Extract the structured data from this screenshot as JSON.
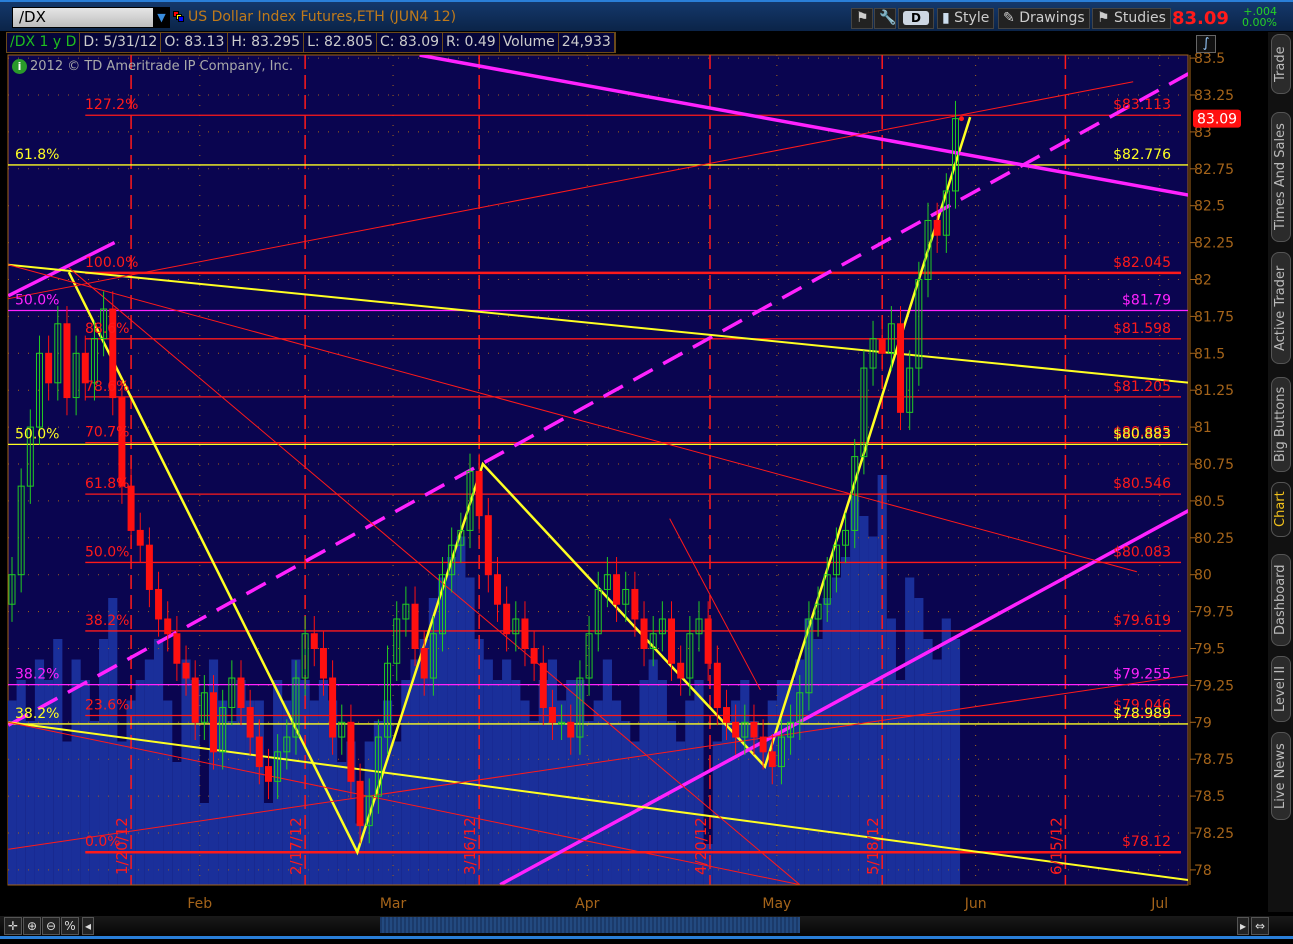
{
  "header": {
    "symbol": "/DX",
    "title": "US Dollar Index Futures,ETH (JUN4 12)",
    "buttons": {
      "style": "Style",
      "drawings": "Drawings",
      "studies": "Studies",
      "d": "D"
    },
    "last_price": "83.09",
    "change": "+.004",
    "change_pct": "0.00%"
  },
  "infobar": {
    "study": "/DX 1 y D",
    "date": "D: 5/31/12",
    "open": "O: 83.13",
    "high": "H: 83.295",
    "low": "L: 82.805",
    "close": "C: 83.09",
    "range": "R: 0.49",
    "volume_label": "Volume",
    "volume": "24,933"
  },
  "copyright": "2012 © TD Ameritrade IP Company, Inc.",
  "sidebar_tabs": [
    "Trade",
    "Times And Sales",
    "Active Trader",
    "Big Buttons",
    "Chart",
    "Dashboard",
    "Level II",
    "Live News"
  ],
  "active_tab": "Chart",
  "colors": {
    "bg": "#0a0550",
    "volume": "#1a2f9a",
    "up": "#22cc22",
    "down": "#ff1010",
    "fib": "#ff1a1a",
    "yellow": "#ffff22",
    "magenta": "#ff22ff",
    "axis": "#a5641a"
  },
  "chart_data": {
    "type": "candlestick",
    "title": "/DX 1 y D",
    "ylim": [
      77.9,
      83.55
    ],
    "yticks": [
      78,
      78.25,
      78.5,
      78.75,
      79,
      79.25,
      79.5,
      79.75,
      80,
      80.25,
      80.5,
      80.75,
      81,
      81.25,
      81.5,
      81.75,
      82,
      82.25,
      82.5,
      82.75,
      83,
      83.25,
      83.5
    ],
    "xticks": [
      {
        "label": "Feb",
        "bar": 20.5
      },
      {
        "label": "Mar",
        "bar": 41.6
      },
      {
        "label": "Apr",
        "bar": 62.8
      },
      {
        "label": "May",
        "bar": 83.5
      },
      {
        "label": "Jun",
        "bar": 105.2
      },
      {
        "label": "Jul",
        "bar": 125.3
      }
    ],
    "first_open": 79.8,
    "close": [
      80.0,
      80.6,
      81.0,
      81.5,
      81.3,
      81.7,
      81.2,
      81.5,
      81.3,
      81.6,
      81.8,
      81.2,
      80.6,
      80.3,
      80.2,
      79.9,
      79.7,
      79.6,
      79.4,
      79.3,
      79.0,
      79.2,
      78.8,
      79.1,
      79.3,
      79.1,
      78.9,
      78.7,
      78.6,
      78.8,
      78.9,
      79.3,
      79.6,
      79.5,
      79.3,
      78.9,
      79.0,
      78.6,
      78.3,
      78.5,
      78.9,
      79.4,
      79.7,
      79.8,
      79.5,
      79.3,
      79.6,
      80.0,
      80.2,
      80.3,
      80.7,
      80.4,
      80.0,
      79.8,
      79.6,
      79.7,
      79.5,
      79.4,
      79.1,
      79.0,
      79.0,
      78.9,
      79.3,
      79.6,
      79.9,
      80.0,
      79.8,
      79.9,
      79.7,
      79.5,
      79.6,
      79.7,
      79.4,
      79.3,
      79.6,
      79.7,
      79.4,
      79.1,
      79.0,
      78.9,
      79.0,
      78.9,
      78.8,
      78.7,
      78.9,
      79.0,
      79.2,
      79.7,
      79.8,
      80.0,
      80.2,
      80.3,
      80.8,
      81.4,
      81.6,
      81.5,
      81.7,
      81.1,
      81.4,
      82.0,
      82.4,
      82.3,
      82.6,
      83.09
    ],
    "volume_relative": [
      45,
      50,
      40,
      55,
      50,
      60,
      35,
      55,
      50,
      40,
      60,
      70,
      35,
      45,
      50,
      55,
      60,
      45,
      30,
      55,
      50,
      20,
      55,
      45,
      40,
      50,
      45,
      45,
      20,
      50,
      45,
      55,
      50,
      45,
      50,
      45,
      30,
      35,
      15,
      35,
      40,
      45,
      35,
      50,
      55,
      60,
      70,
      75,
      80,
      85,
      75,
      60,
      55,
      50,
      55,
      50,
      45,
      40,
      50,
      55,
      45,
      50,
      50,
      40,
      45,
      55,
      45,
      40,
      35,
      50,
      55,
      50,
      40,
      35,
      45,
      50,
      10,
      35,
      40,
      45,
      50,
      40,
      35,
      45,
      50,
      50,
      55,
      65,
      60,
      70,
      75,
      80,
      95,
      90,
      85,
      100,
      65,
      50,
      75,
      70,
      60,
      55,
      65,
      60
    ],
    "current_price_marker": "83.09",
    "fib_levels_red": [
      {
        "pct": "127.2%",
        "price": 83.113,
        "label": "$83.113"
      },
      {
        "pct": "100.0%",
        "price": 82.045,
        "label": "$82.045"
      },
      {
        "pct": "88.6%",
        "price": 81.598,
        "label": "$81.598"
      },
      {
        "pct": "78.6%",
        "price": 81.205,
        "label": "$81.205"
      },
      {
        "pct": "70.7%",
        "price": 80.895,
        "label": "$80.895"
      },
      {
        "pct": "61.8%",
        "price": 80.546,
        "label": "$80.546"
      },
      {
        "pct": "50.0%",
        "price": 80.083,
        "label": "$80.083"
      },
      {
        "pct": "38.2%",
        "price": 79.619,
        "label": "$79.619"
      },
      {
        "pct": "23.6%",
        "price": 79.046,
        "label": "$79.046"
      },
      {
        "pct": "0.0%",
        "price": 78.12,
        "label": "$78.12"
      }
    ],
    "fib_levels_yellow": [
      {
        "pct": "61.8%",
        "price": 82.776,
        "label": "$82.776"
      },
      {
        "pct": "50.0%",
        "price": 80.883,
        "label": "$80.883"
      },
      {
        "pct": "38.2%",
        "price": 78.989,
        "label": "$78.989"
      }
    ],
    "fib_levels_magenta": [
      {
        "pct": "50.0%",
        "price": 81.79,
        "label": "$81.79"
      },
      {
        "pct": "38.2%",
        "price": 79.255,
        "label": "$79.255"
      }
    ],
    "date_lines": [
      {
        "label": "1/20/12",
        "bar": 13
      },
      {
        "label": "2/17/12",
        "bar": 32
      },
      {
        "label": "3/16/12",
        "bar": 51
      },
      {
        "label": "4/20/12",
        "bar": 76.2
      },
      {
        "label": "5/18/12",
        "bar": 95
      },
      {
        "label": "6/15/12",
        "bar": 115
      }
    ],
    "drawings": [
      {
        "kind": "zigzag",
        "color": "yellow",
        "points": [
          [
            6.2,
            82.05
          ],
          [
            37.7,
            78.12
          ],
          [
            51.4,
            80.75
          ],
          [
            82.2,
            78.7
          ],
          [
            104.6,
            83.1
          ]
        ]
      },
      {
        "kind": "line",
        "color": "magenta",
        "dash": true,
        "points": [
          [
            -0.4,
            78.98
          ],
          [
            128.6,
            83.4
          ]
        ]
      },
      {
        "kind": "line",
        "color": "magenta",
        "points": [
          [
            53.3,
            77.9
          ],
          [
            128.6,
            80.44
          ]
        ]
      },
      {
        "kind": "line",
        "color": "magenta",
        "points": [
          [
            44.5,
            83.52
          ],
          [
            128.6,
            82.57
          ]
        ]
      },
      {
        "kind": "line",
        "color": "magenta",
        "points": [
          [
            -0.4,
            81.89
          ],
          [
            11.2,
            82.25
          ]
        ]
      },
      {
        "kind": "line",
        "color": "yellow",
        "points": [
          [
            -0.4,
            82.1
          ],
          [
            128.6,
            81.3
          ]
        ]
      },
      {
        "kind": "line",
        "color": "yellow",
        "points": [
          [
            -0.4,
            79.0
          ],
          [
            128.6,
            77.93
          ]
        ]
      },
      {
        "kind": "line",
        "color": "red",
        "points": [
          [
            -0.4,
            82.1
          ],
          [
            122.8,
            80.02
          ]
        ]
      },
      {
        "kind": "line",
        "color": "red",
        "points": [
          [
            6.2,
            82.08
          ],
          [
            86.0,
            77.9
          ]
        ]
      },
      {
        "kind": "line",
        "color": "red",
        "points": [
          [
            -0.4,
            79.0
          ],
          [
            86.0,
            77.9
          ]
        ]
      },
      {
        "kind": "line",
        "color": "red",
        "points": [
          [
            -0.4,
            81.87
          ],
          [
            122.4,
            83.34
          ]
        ]
      },
      {
        "kind": "line",
        "color": "red",
        "points": [
          [
            -0.4,
            78.14
          ],
          [
            128.6,
            79.32
          ]
        ]
      },
      {
        "kind": "line",
        "color": "red",
        "points": [
          [
            71.8,
            80.38
          ],
          [
            81.7,
            79.22
          ]
        ]
      }
    ]
  }
}
